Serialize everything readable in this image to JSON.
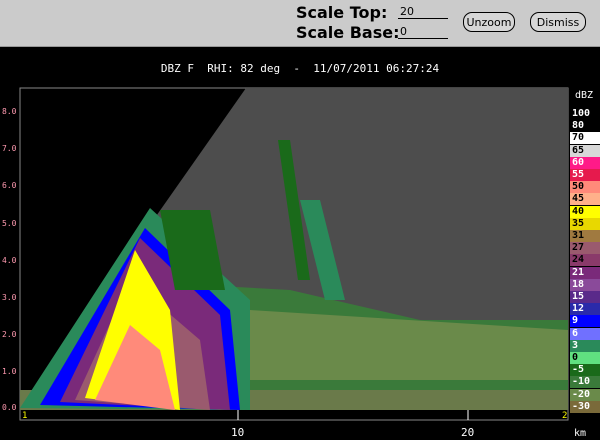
{
  "toolbar": {
    "scale_top_label": "Scale Top:",
    "scale_top_value": "20",
    "scale_base_label": "Scale Base:",
    "scale_base_value": "0",
    "unzoom_label": "Unzoom",
    "dismiss_label": "Dismiss"
  },
  "plot": {
    "title": "DBZ F  RHI: 82 deg  -  11/07/2011 06:27:24",
    "y_ticks": [
      "8.0",
      "7.0",
      "6.0",
      "5.0",
      "4.0",
      "3.0",
      "2.0",
      "1.0",
      "0.0"
    ],
    "x_ticks": [
      "10",
      "20"
    ],
    "x_unit": "km",
    "corner_left": "1",
    "corner_right": "2",
    "background_color": "#4d4d4d"
  },
  "colorbar": {
    "unit": "dBZ",
    "levels": [
      {
        "label": "100",
        "color": "#000000",
        "text": "#ffffff"
      },
      {
        "label": "80",
        "color": "#000000",
        "text": "#ffffff"
      },
      {
        "label": "70",
        "color": "#ffffff",
        "text": "#000000"
      },
      {
        "label": "65",
        "color": "#d8d8d8",
        "text": "#000000"
      },
      {
        "label": "60",
        "color": "#ff1a88",
        "text": "#ffffff"
      },
      {
        "label": "55",
        "color": "#e61a4d",
        "text": "#ffffff"
      },
      {
        "label": "50",
        "color": "#ff8a7a",
        "text": "#000000"
      },
      {
        "label": "45",
        "color": "#ffb08a",
        "text": "#000000"
      },
      {
        "label": "40",
        "color": "#ffff00",
        "text": "#000000"
      },
      {
        "label": "35",
        "color": "#e8d800",
        "text": "#000000"
      },
      {
        "label": "31",
        "color": "#a07a40",
        "text": "#000000"
      },
      {
        "label": "27",
        "color": "#9a5a6e",
        "text": "#000000"
      },
      {
        "label": "24",
        "color": "#8a3a6a",
        "text": "#000000"
      },
      {
        "label": "21",
        "color": "#7a2a7a",
        "text": "#ffffff"
      },
      {
        "label": "18",
        "color": "#8a4a9a",
        "text": "#ffffff"
      },
      {
        "label": "15",
        "color": "#5a2a8a",
        "text": "#ffffff"
      },
      {
        "label": "12",
        "color": "#2a2aaa",
        "text": "#ffffff"
      },
      {
        "label": "9",
        "color": "#0000ff",
        "text": "#ffffff"
      },
      {
        "label": "6",
        "color": "#7070ff",
        "text": "#ffffff"
      },
      {
        "label": "3",
        "color": "#2a8a5a",
        "text": "#ffffff"
      },
      {
        "label": "0",
        "color": "#60e080",
        "text": "#000000"
      },
      {
        "label": "-5",
        "color": "#1a6a1a",
        "text": "#ffffff"
      },
      {
        "label": "-10",
        "color": "#3a7a3a",
        "text": "#ffffff"
      },
      {
        "label": "-20",
        "color": "#6a8a4a",
        "text": "#ffffff"
      },
      {
        "label": "-30",
        "color": "#7a6a3a",
        "text": "#ffffff"
      }
    ]
  }
}
